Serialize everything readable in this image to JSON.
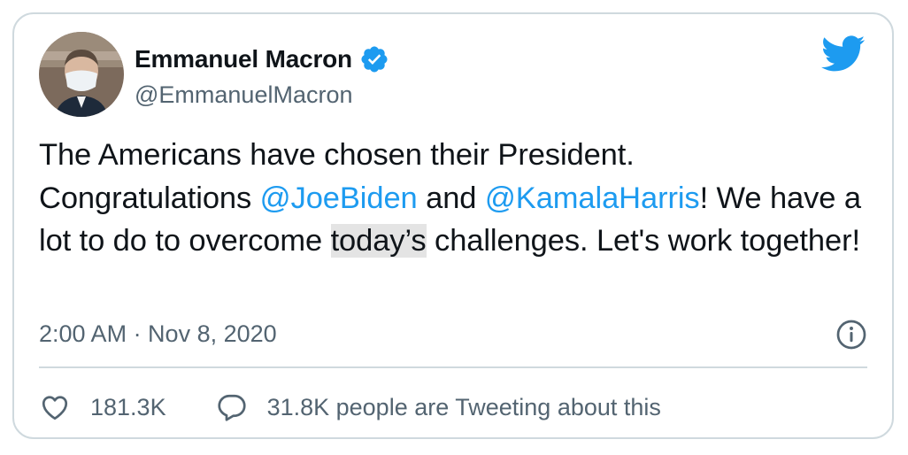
{
  "author": {
    "name": "Emmanuel Macron",
    "handle": "@EmmanuelMacron"
  },
  "tweet": {
    "line1": "The Americans have chosen their President.",
    "segment_congrats": "Congratulations ",
    "mention_1": "@JoeBiden",
    "segment_and": " and ",
    "mention_2": "@KamalaHarris",
    "segment_we": "! We have a lot to do to overcome ",
    "highlighted_word": "today’s",
    "segment_end": " challenges. Let's work together!"
  },
  "timestamp": "2:00 AM · Nov 8, 2020",
  "actions": {
    "likes": "181.3K",
    "conversation": "31.8K people are Tweeting about this"
  },
  "colors": {
    "link": "#1d9bf0",
    "secondary_text": "#536471",
    "border": "#cfd9de"
  },
  "icons": [
    "verified-badge-icon",
    "twitter-bird-icon",
    "info-icon",
    "heart-icon",
    "reply-bubble-icon"
  ]
}
